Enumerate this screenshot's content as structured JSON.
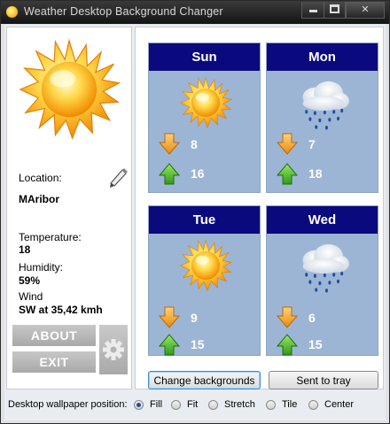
{
  "window": {
    "title": "Weather Desktop Background Changer",
    "controls": [
      "minimize",
      "maximize",
      "close"
    ]
  },
  "current": {
    "location_label": "Location:",
    "location": "MAribor",
    "temperature_label": "Temperature:",
    "temperature": "18",
    "humidity_label": "Humidity:",
    "humidity": "59%",
    "wind_label": "Wind",
    "wind": "SW at 35,42 kmh",
    "icon": "sun-icon"
  },
  "buttons": {
    "about": "ABOUT",
    "exit": "EXIT",
    "change_backgrounds": "Change backgrounds",
    "sent_to_tray": "Sent to tray"
  },
  "forecast": [
    {
      "day": "Sun",
      "icon": "sun-icon",
      "low": "8",
      "high": "16"
    },
    {
      "day": "Mon",
      "icon": "rain-cloud-icon",
      "low": "7",
      "high": "18"
    },
    {
      "day": "Tue",
      "icon": "sun-icon",
      "low": "9",
      "high": "15"
    },
    {
      "day": "Wed",
      "icon": "rain-cloud-icon",
      "low": "6",
      "high": "15"
    }
  ],
  "wallpaper": {
    "label": "Desktop wallpaper position:",
    "options": [
      "Fill",
      "Fit",
      "Stretch",
      "Tile",
      "Center"
    ],
    "selected": "Fill"
  },
  "colors": {
    "card_header": "#0a0a7e",
    "card_body": "#9db5d5",
    "low_arrow": "#f5a623",
    "high_arrow": "#4caf2a"
  }
}
